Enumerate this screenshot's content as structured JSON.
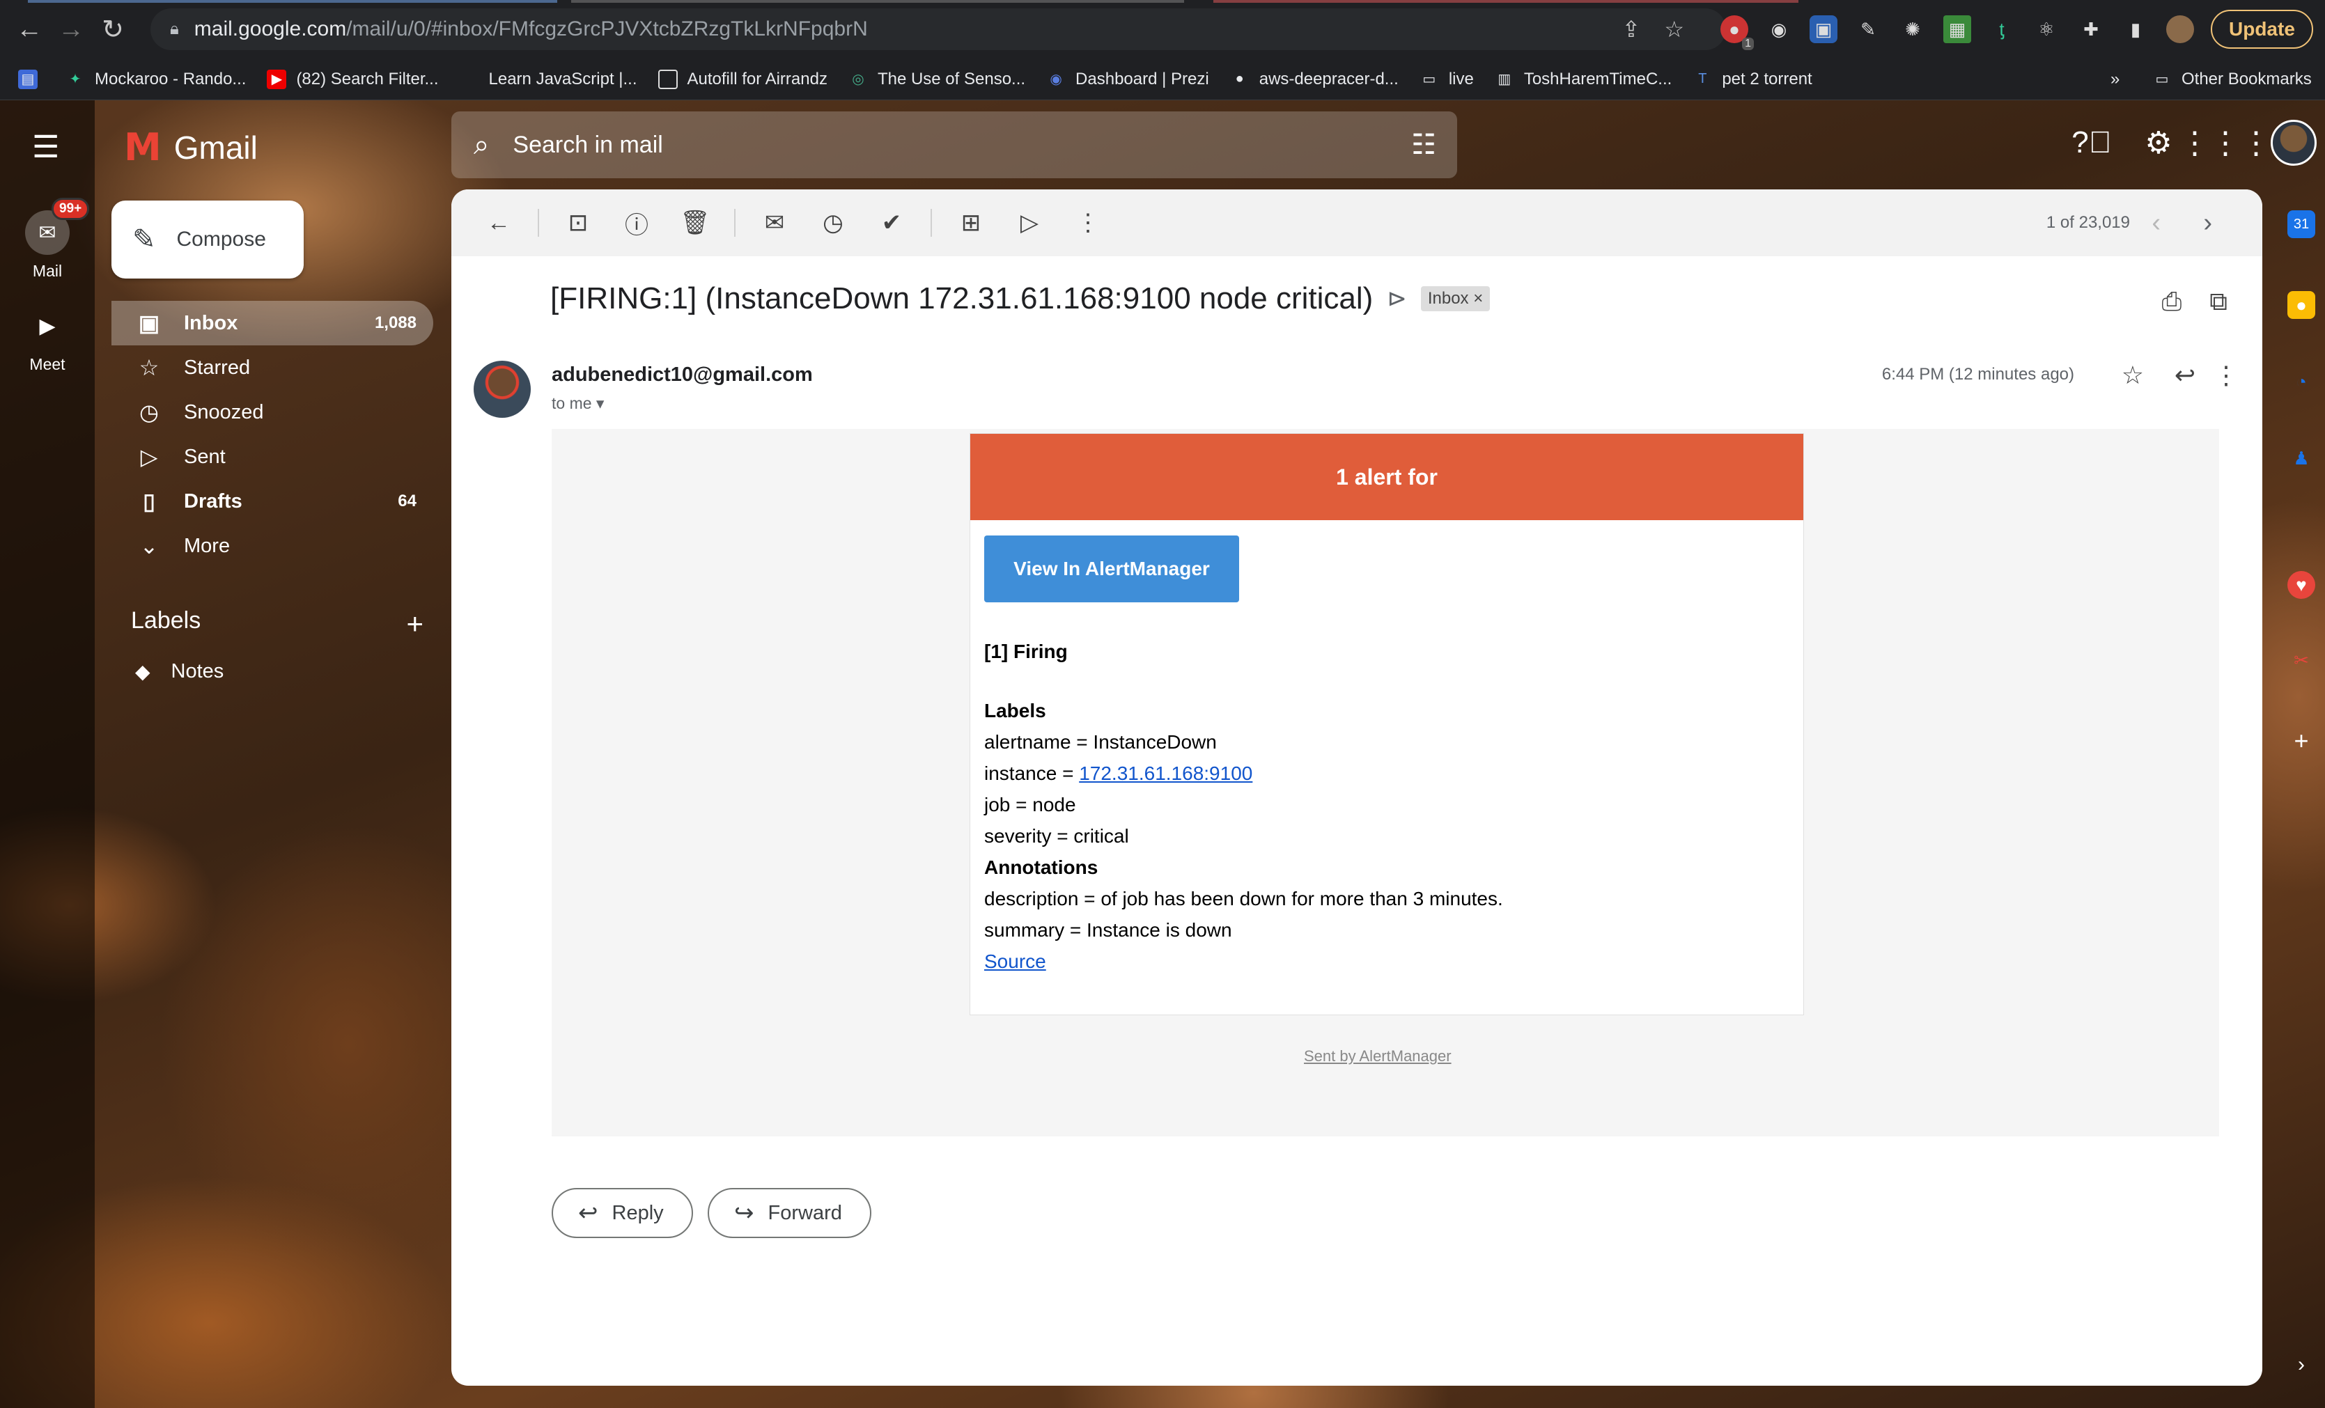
{
  "browser": {
    "url_host": "mail.google.com",
    "url_path": "/mail/u/0/#inbox/FMfcgzGrcPJVXtcbZRzgTkLkrNFpqbrN",
    "update_label": "Update",
    "bookmarks": [
      "Mockaroo - Rando...",
      "(82) Search Filter...",
      "Learn JavaScript |...",
      "Autofill for Airrandz",
      "The Use of Senso...",
      "Dashboard | Prezi",
      "aws-deepracer-d...",
      "live",
      "ToshHaremTimeC...",
      "pet 2 torrent"
    ],
    "more_bookmarks": "»",
    "other_bookmarks": "Other Bookmarks",
    "ext_badge": "1"
  },
  "rail": {
    "mail_label": "Mail",
    "mail_badge": "99+",
    "meet_label": "Meet"
  },
  "header": {
    "logo_text": "Gmail",
    "search_placeholder": "Search in mail"
  },
  "compose_label": "Compose",
  "nav": [
    {
      "label": "Inbox",
      "count": "1,088",
      "icon": "inbox-icon"
    },
    {
      "label": "Starred",
      "count": "",
      "icon": "star-icon"
    },
    {
      "label": "Snoozed",
      "count": "",
      "icon": "clock-icon"
    },
    {
      "label": "Sent",
      "count": "",
      "icon": "send-icon"
    },
    {
      "label": "Drafts",
      "count": "64",
      "icon": "draft-icon"
    },
    {
      "label": "More",
      "count": "",
      "icon": "chevron-down-icon"
    }
  ],
  "labels": {
    "title": "Labels",
    "add": "+",
    "items": [
      "Notes"
    ]
  },
  "toolbar": {
    "pager": "1 of 23,019"
  },
  "email": {
    "subject": "[FIRING:1] (InstanceDown 172.31.61.168:9100 node critical)",
    "tag": "Inbox ×",
    "sender": "adubenedict10@gmail.com",
    "to": "to me",
    "time": "6:44 PM (12 minutes ago)",
    "alert_header": "1 alert for",
    "am_button": "View In AlertManager",
    "firing": "[1] Firing",
    "labels_h": "Labels",
    "alertname": "alertname = InstanceDown",
    "instance_prefix": "instance = ",
    "instance_link": "172.31.61.168:9100",
    "job": "job = node",
    "severity": "severity = critical",
    "annotations_h": "Annotations",
    "description": "description = of job has been down for more than 3 minutes.",
    "summary": "summary = Instance is down",
    "source": "Source",
    "sent_by": "Sent by AlertManager"
  },
  "actions": {
    "reply": "Reply",
    "forward": "Forward"
  },
  "colors": {
    "alert_header": "#e05d3a",
    "am_button": "#3f8ed8",
    "link": "#1155cc"
  }
}
